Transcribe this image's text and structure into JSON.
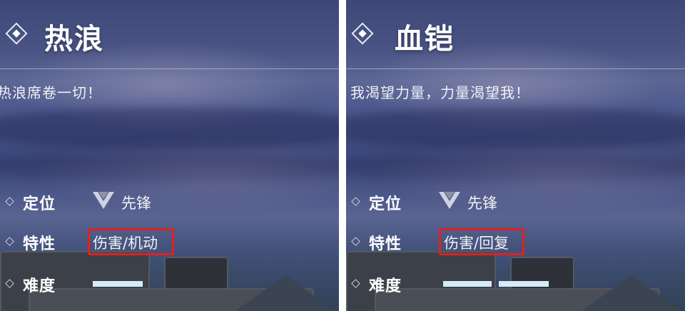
{
  "panels": [
    {
      "title": "热浪",
      "slogan": "热浪席卷一切！",
      "role_label": "定位",
      "role_value": "先锋",
      "role_icon": "vanguard-chevron-icon",
      "trait_label": "特性",
      "trait_value": "伤害/机动",
      "difficulty_label": "难度",
      "difficulty_level": 1,
      "difficulty_max": 3
    },
    {
      "title": "血铠",
      "slogan": "我渴望力量，力量渴望我！",
      "role_label": "定位",
      "role_value": "先锋",
      "role_icon": "vanguard-chevron-icon",
      "trait_label": "特性",
      "trait_value": "伤害/回复",
      "difficulty_label": "难度",
      "difficulty_level": 2,
      "difficulty_max": 3
    }
  ],
  "colors": {
    "highlight": "#e02121",
    "difficulty_fill": "#d4ecf8",
    "divider": "#ffffff"
  }
}
